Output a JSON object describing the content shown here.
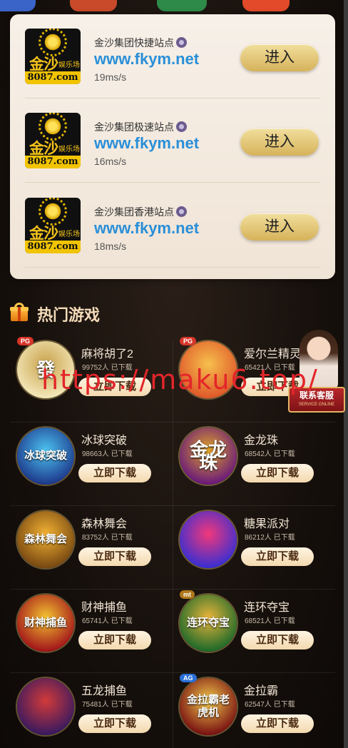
{
  "stations": [
    {
      "name": "金沙集团快捷站点",
      "url": "www.fkym.net",
      "ping": "19ms/s",
      "enter_label": "进入",
      "logo": {
        "cn": "金沙",
        "sub": "娱乐场",
        "domain": "8087.com"
      }
    },
    {
      "name": "金沙集团极速站点",
      "url": "www.fkym.net",
      "ping": "16ms/s",
      "enter_label": "进入",
      "logo": {
        "cn": "金沙",
        "sub": "娱乐场",
        "domain": "8087.com"
      }
    },
    {
      "name": "金沙集团香港站点",
      "url": "www.fkym.net",
      "ping": "18ms/s",
      "enter_label": "进入",
      "logo": {
        "cn": "金沙",
        "sub": "娱乐场",
        "domain": "8087.com"
      }
    }
  ],
  "hot_games": {
    "title": "热门游戏",
    "icon": "gift-icon",
    "download_label": "立即下载",
    "items": [
      {
        "name": "麻将胡了2",
        "count": "99752人 已下载",
        "tag": "PG",
        "icon_text": "發",
        "colors": [
          "#f3e7b8",
          "#c9a24c"
        ]
      },
      {
        "name": "爱尔兰精灵",
        "count": "65421人 已下载",
        "tag": "PG",
        "icon_text": "",
        "colors": [
          "#e05a2b",
          "#f6c04c"
        ]
      },
      {
        "name": "冰球突破",
        "count": "98663人 已下载",
        "tag": "",
        "icon_text": "冰球突破",
        "colors": [
          "#1e3a8c",
          "#4cc3f0"
        ]
      },
      {
        "name": "金龙珠",
        "count": "68542人 已下载",
        "tag": "",
        "icon_text": "金龙珠",
        "colors": [
          "#6a1a7a",
          "#e0a428"
        ]
      },
      {
        "name": "森林舞会",
        "count": "83752人 已下载",
        "tag": "",
        "icon_text": "森林舞会",
        "colors": [
          "#7a4a12",
          "#f2b233"
        ]
      },
      {
        "name": "糖果派对",
        "count": "86212人 已下载",
        "tag": "",
        "icon_text": "",
        "colors": [
          "#3b2fd0",
          "#f2387a"
        ]
      },
      {
        "name": "财神捕鱼",
        "count": "65741人 已下载",
        "tag": "",
        "icon_text": "财神捕鱼",
        "colors": [
          "#a3161a",
          "#f3c331"
        ]
      },
      {
        "name": "连环夺宝",
        "count": "68521人 已下载",
        "tag": "mt",
        "icon_text": "连环夺宝",
        "colors": [
          "#1f6a2a",
          "#e8b43a"
        ]
      },
      {
        "name": "五龙捕鱼",
        "count": "75481人 已下载",
        "tag": "",
        "icon_text": "",
        "colors": [
          "#3a1a5e",
          "#d23a3a"
        ]
      },
      {
        "name": "金拉霸",
        "count": "62547人 已下载",
        "tag": "AG",
        "icon_text": "金拉霸老虎机",
        "colors": [
          "#7a1212",
          "#f1c94a"
        ]
      }
    ]
  },
  "service": {
    "label": "联系客服",
    "sub": "SERVICE ONLINE"
  },
  "watermark": "https://maku6.top/",
  "top_strip_colors": [
    "#3a64c8",
    "#c84a2a",
    "#2e8a48",
    "#e24a2a"
  ]
}
